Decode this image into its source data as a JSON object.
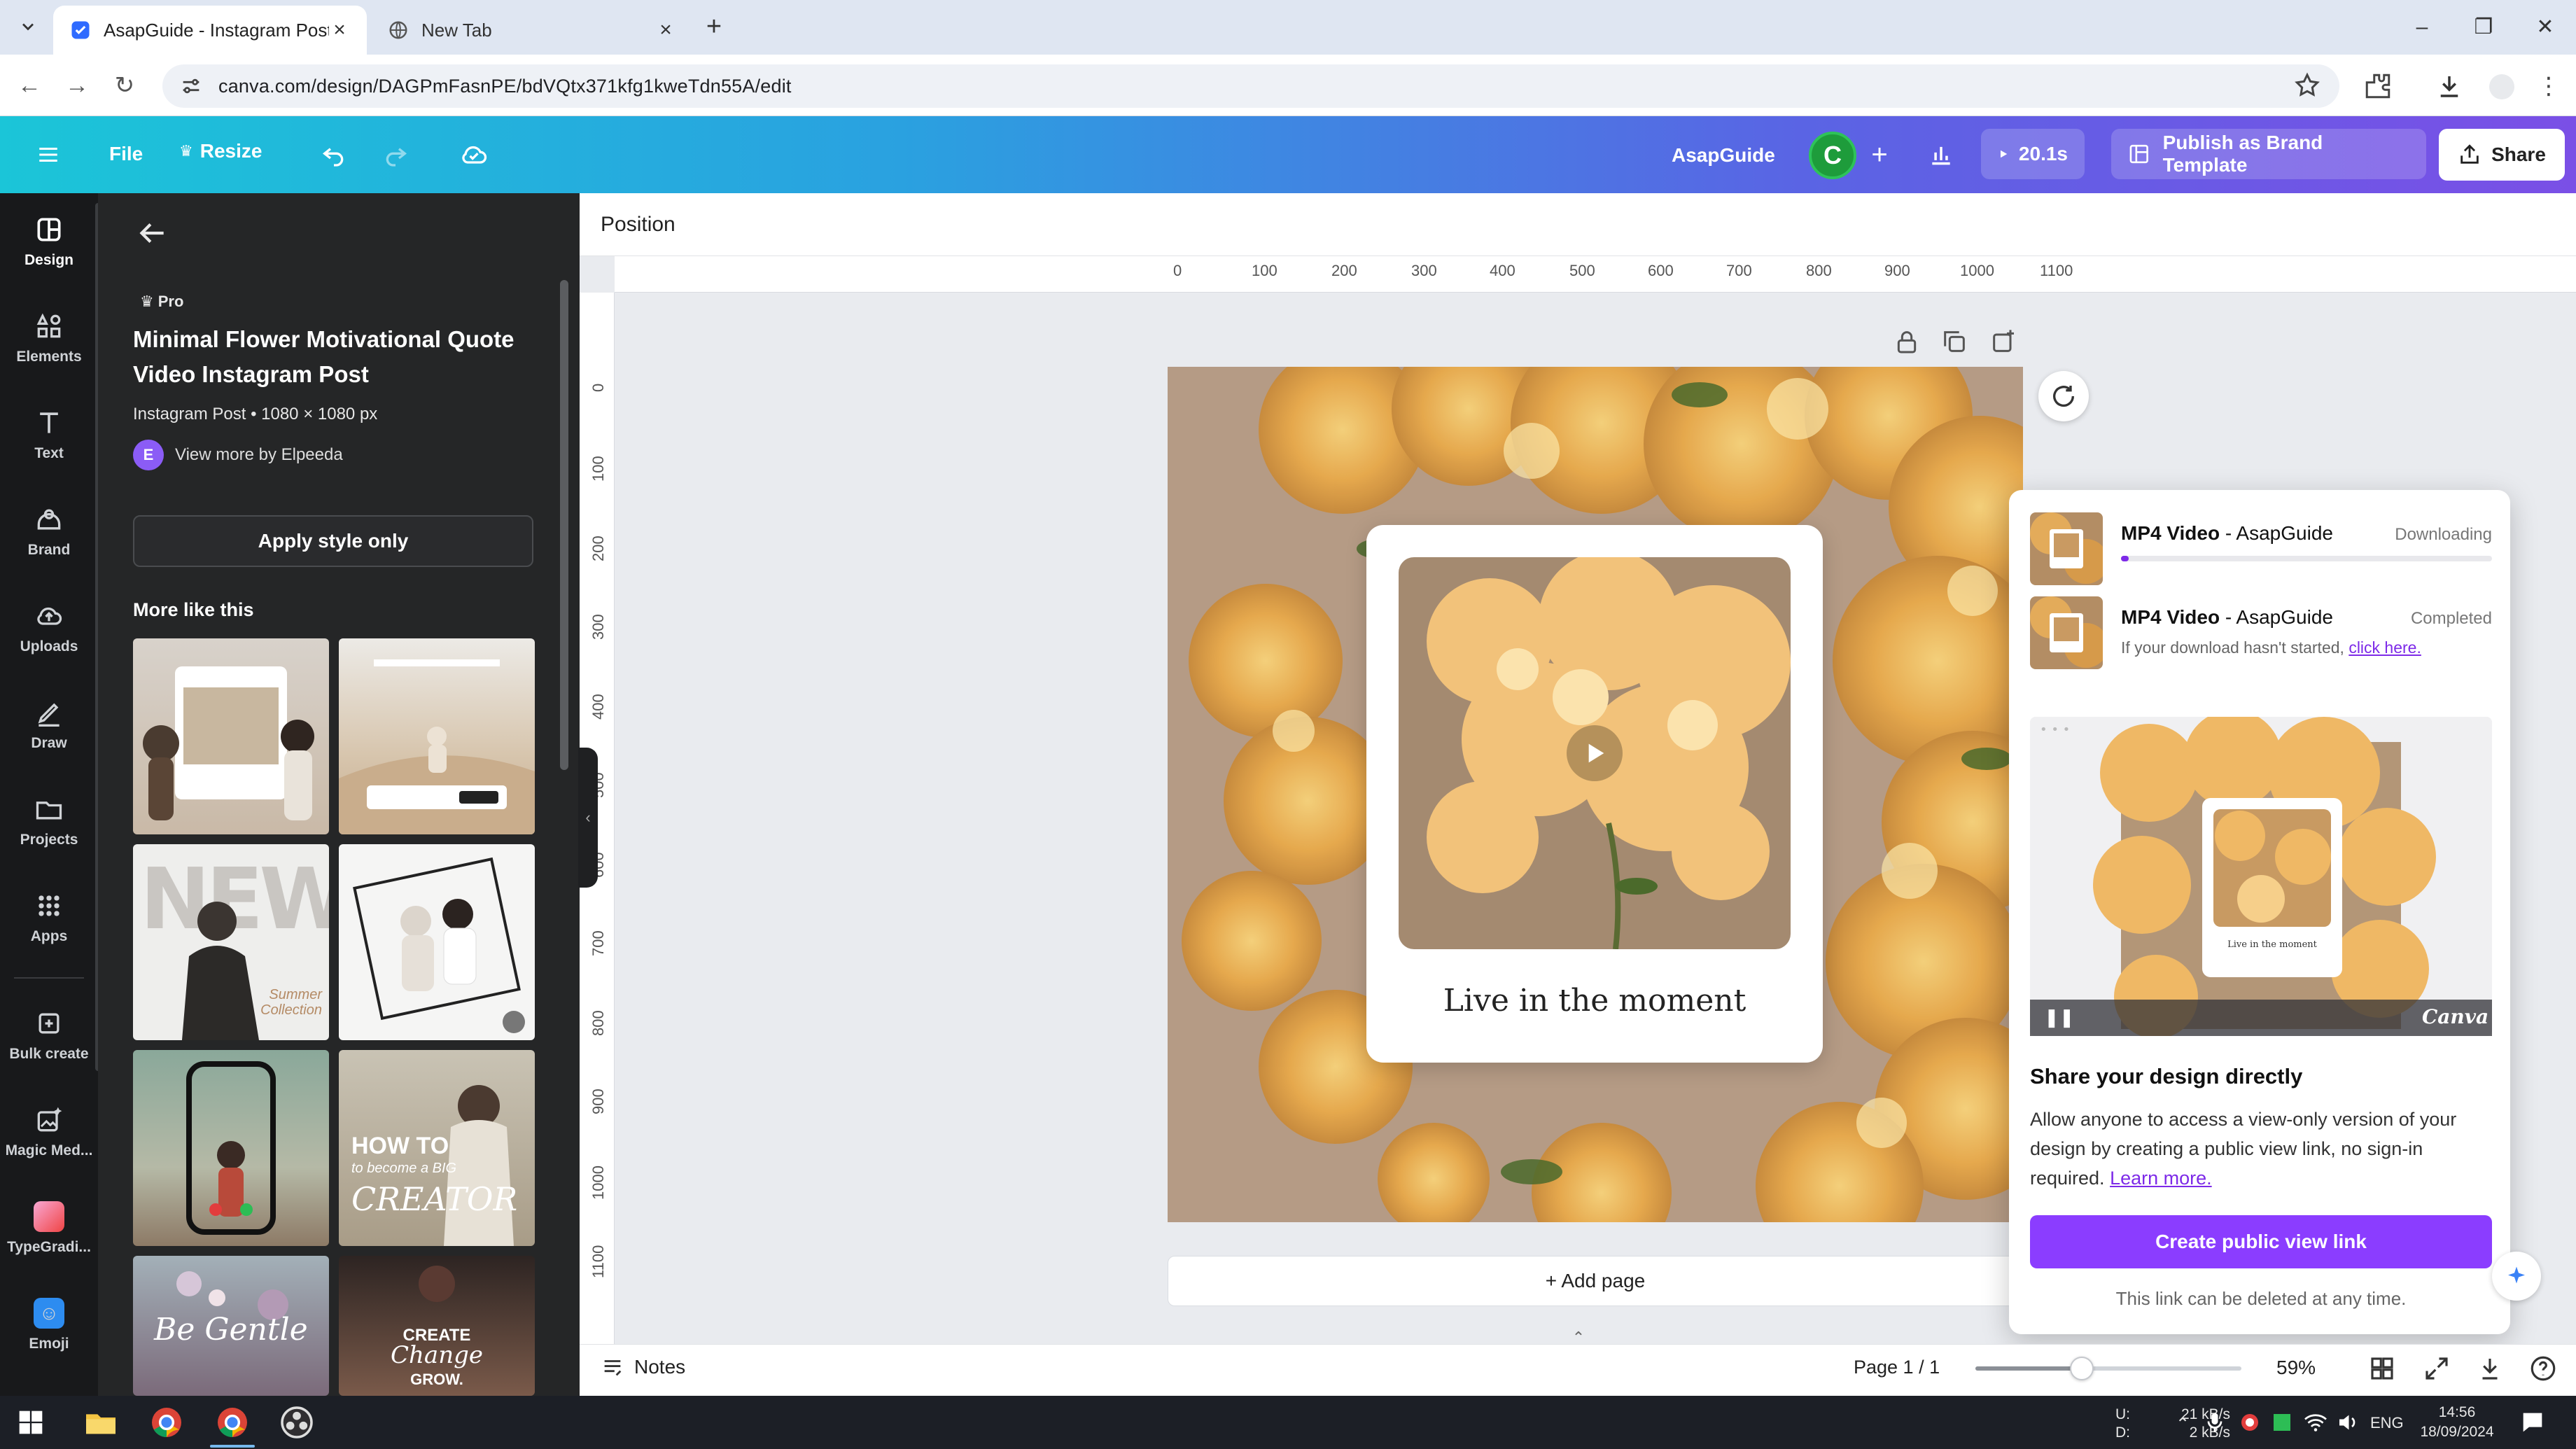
{
  "browser": {
    "tabs": [
      {
        "label": "AsapGuide - Instagram Post",
        "active": true
      },
      {
        "label": "New Tab",
        "active": false
      }
    ],
    "url": "canva.com/design/DAGPmFasnPE/bdVQtx371kfg1kweTdn55A/edit"
  },
  "topbar": {
    "file_label": "File",
    "resize_label": "Resize",
    "team_name": "AsapGuide",
    "avatar_letter": "C",
    "play_time": "20.1s",
    "publish_label": "Publish as Brand Template",
    "share_label": "Share"
  },
  "rail": {
    "items": [
      {
        "label": "Design",
        "icon": "design-icon"
      },
      {
        "label": "Elements",
        "icon": "elements-icon"
      },
      {
        "label": "Text",
        "icon": "text-icon"
      },
      {
        "label": "Brand",
        "icon": "brand-icon"
      },
      {
        "label": "Uploads",
        "icon": "uploads-icon"
      },
      {
        "label": "Draw",
        "icon": "draw-icon"
      },
      {
        "label": "Projects",
        "icon": "projects-icon"
      },
      {
        "label": "Apps",
        "icon": "apps-icon"
      },
      {
        "label": "Bulk create",
        "icon": "bulk-create-icon"
      },
      {
        "label": "Magic Med...",
        "icon": "magic-media-icon"
      },
      {
        "label": "TypeGradi...",
        "icon": "typegradient-icon"
      },
      {
        "label": "Emoji",
        "icon": "emoji-icon"
      }
    ]
  },
  "panel": {
    "badge": "Pro",
    "title": "Minimal Flower Motivational Quote Video Instagram Post",
    "subtitle": "Instagram Post • 1080 × 1080 px",
    "author_initial": "E",
    "author_link": "View more by Elpeeda",
    "apply_label": "Apply style only",
    "more_title": "More like this",
    "thumb_texts": {
      "new": "NEW",
      "summer": "Summer Collection",
      "howto": "HOW TO",
      "become": "to become a BIG",
      "creator": "CREATOR",
      "gentle": "Be Gentle",
      "create": "CREATE",
      "change": "Change",
      "grow": "GROW."
    }
  },
  "workspace": {
    "position_label": "Position",
    "ruler_h": [
      "0",
      "100",
      "200",
      "300",
      "400",
      "500",
      "600",
      "700",
      "800",
      "900",
      "1000",
      "1100"
    ],
    "ruler_v": [
      "0",
      "100",
      "200",
      "300",
      "400",
      "500",
      "600",
      "700",
      "800",
      "900",
      "1000",
      "1100"
    ],
    "quote": "Live in the moment",
    "add_page_label": "+ Add page"
  },
  "share_popover": {
    "downloads": [
      {
        "format": "MP4 Video",
        "name": " - AsapGuide",
        "status": "Downloading",
        "progress": 0.02
      },
      {
        "format": "MP4 Video",
        "name": " - AsapGuide",
        "status": "Completed",
        "note": "If your download hasn't started, ",
        "note_link": "click here."
      }
    ],
    "preview_mini_quote": "Live in the moment",
    "preview_brand": "Canva",
    "title": "Share your design directly",
    "description": "Allow anyone to access a view-only version of your design by creating a public view link, no sign-in required. ",
    "learn_more": "Learn more.",
    "button_label": "Create public view link",
    "footer": "This link can be deleted at any time."
  },
  "bottombar": {
    "notes_label": "Notes",
    "page_indicator": "Page 1 / 1",
    "zoom": "59%",
    "zoom_fraction": 0.4
  },
  "taskbar": {
    "net_upload_label": "U:",
    "net_download_label": "D:",
    "net_up": "21 kB/s",
    "net_down": "2 kB/s",
    "lang": "ENG",
    "time": "14:56",
    "date": "18/09/2024"
  },
  "colors": {
    "accent": "#8b3dff",
    "rail_bg": "#18191b",
    "panel_bg": "#252627"
  }
}
